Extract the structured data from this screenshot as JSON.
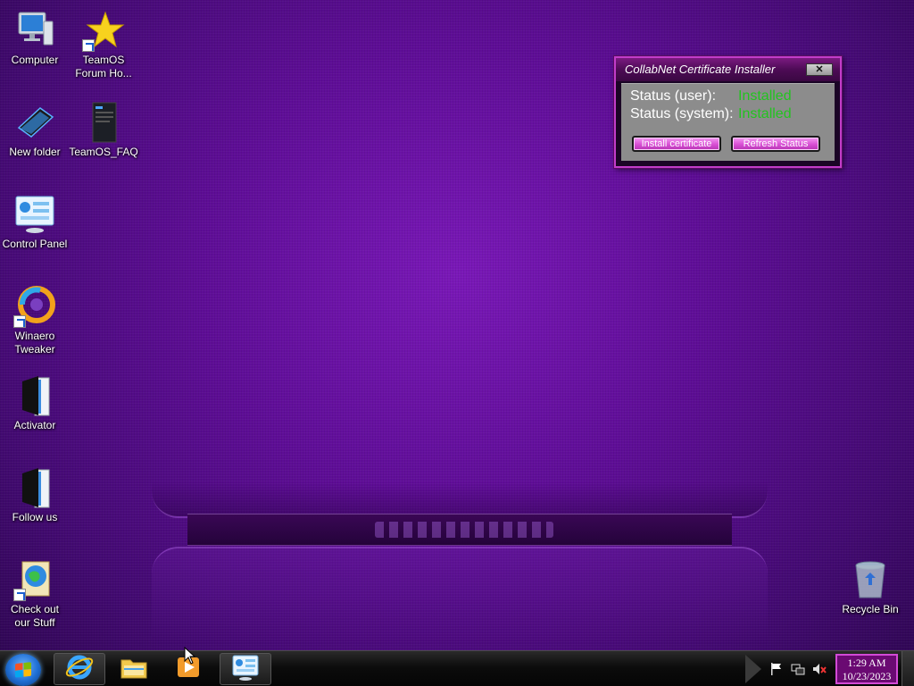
{
  "desktop": {
    "icons": [
      {
        "label": "Computer",
        "icon": "computer-icon"
      },
      {
        "label": "TeamOS\nForum Ho...",
        "icon": "star-shortcut-icon"
      },
      {
        "label": "New folder",
        "icon": "folder-icon"
      },
      {
        "label": "TeamOS_FAQ",
        "icon": "document-icon"
      },
      {
        "label": "Control Panel",
        "icon": "control-panel-icon"
      },
      {
        "label": "Winaero\nTweaker",
        "icon": "winaero-tweaker-icon"
      },
      {
        "label": "Activator",
        "icon": "activator-icon"
      },
      {
        "label": "Follow us",
        "icon": "book-icon"
      },
      {
        "label": "Check out\nour Stuff",
        "icon": "globe-shortcut-icon"
      },
      {
        "label": "Recycle Bin",
        "icon": "recycle-bin-icon"
      }
    ]
  },
  "window": {
    "title": "CollabNet Certificate Installer",
    "close_label": "✕",
    "rows": [
      {
        "label": "Status (user):",
        "value": "Installed"
      },
      {
        "label": "Status (system):",
        "value": "Installed"
      }
    ],
    "install_button": "Install certificate",
    "refresh_button": "Refresh Status",
    "value_color": "#22c41f"
  },
  "taskbar": {
    "apps": [
      {
        "name": "internet-explorer",
        "icon": "internet-explorer-icon",
        "active": true
      },
      {
        "name": "file-explorer",
        "icon": "folder-icon",
        "active": false
      },
      {
        "name": "media-player",
        "icon": "media-player-icon",
        "active": false
      },
      {
        "name": "control-panel",
        "icon": "control-panel-icon",
        "active": true
      }
    ],
    "tray_icons": [
      "flag-icon",
      "network-icon",
      "volume-muted-icon"
    ],
    "clock": {
      "time": "1:29 AM",
      "date": "10/23/2023"
    }
  },
  "colors": {
    "accent": "#d24ad6",
    "wallpaper": "#5e0d96"
  }
}
